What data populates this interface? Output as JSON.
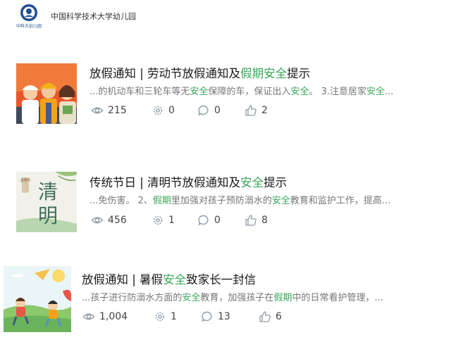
{
  "header": {
    "logo_text": "中科大幼儿园",
    "org_name": "中国科学技术大学幼儿园"
  },
  "articles": [
    {
      "title_prefix": "放假通知 | 劳动节放假通知及",
      "title_hl1": "假期",
      "title_hl2": "安全",
      "title_suffix": "提示",
      "snippet_a": "...的机动车和三轮车等无",
      "snippet_hl1": "安全",
      "snippet_b": "保障的车，保证出入",
      "snippet_hl2": "安全",
      "snippet_c": "。 3.注意居家",
      "snippet_hl3": "安全",
      "snippet_d": "...",
      "views": "215",
      "shares": "0",
      "comments": "0",
      "likes": "2"
    },
    {
      "title_prefix": "传统节日 | 清明节放假通知及",
      "title_hl1": "安全",
      "title_suffix": "提示",
      "thumb_text1": "清",
      "thumb_text2": "明",
      "thumb_small": "清明节",
      "snippet_a": "...免伤害。 2、",
      "snippet_hl1": "假期",
      "snippet_b": "里加强对孩子预防溺水的",
      "snippet_hl2": "安全",
      "snippet_c": "教育和监护工作，提高...",
      "views": "456",
      "shares": "1",
      "comments": "0",
      "likes": "8"
    },
    {
      "title_prefix": "放假通知 | 暑假",
      "title_hl1": "安全",
      "title_suffix": "致家长一封信",
      "snippet_a": "...孩子进行防溺水方面的",
      "snippet_hl1": "安全",
      "snippet_b": "教育，加强孩子在",
      "snippet_hl2": "假期",
      "snippet_c": "中的日常看护管理，...",
      "views": "1,004",
      "shares": "1",
      "comments": "13",
      "likes": "6"
    }
  ],
  "colors": {
    "highlight": "#3aa65a",
    "icon": "#8f9aa6"
  }
}
